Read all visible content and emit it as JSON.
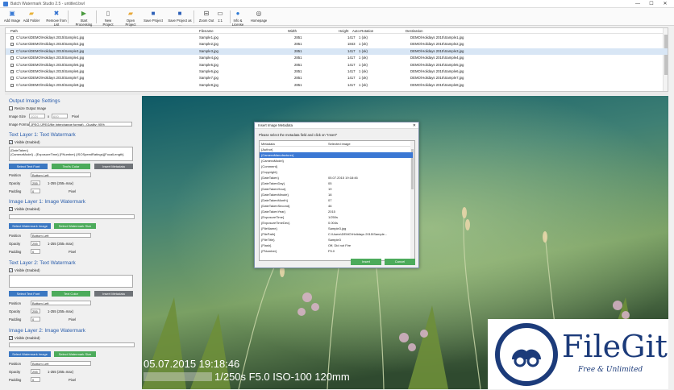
{
  "window": {
    "title": "Batch Watermark Studio 2.5 - untitled.bwl",
    "minimize": "—",
    "maximize": "☐",
    "close": "✕"
  },
  "ribbon": [
    {
      "label": "Add Image",
      "icon": "add-image-icon",
      "glyph": "▣",
      "color": "#3a7bd5"
    },
    {
      "label": "Add Folder",
      "icon": "add-folder-icon",
      "glyph": "▰",
      "color": "#e8b33a"
    },
    {
      "label": "Remove from List",
      "icon": "remove-icon",
      "glyph": "✖",
      "color": "#2f6fcf"
    },
    {
      "label": "Start Processing",
      "icon": "play-icon",
      "glyph": "▶",
      "color": "#4a9a3e"
    },
    {
      "label": "New Project",
      "icon": "new-project-icon",
      "glyph": "▯",
      "color": "#666666"
    },
    {
      "label": "Open Project",
      "icon": "open-project-icon",
      "glyph": "▰",
      "color": "#e8a93a"
    },
    {
      "label": "Save Project",
      "icon": "save-project-icon",
      "glyph": "■",
      "color": "#2f62b8"
    },
    {
      "label": "Save Project as ...",
      "icon": "save-as-icon",
      "glyph": "■",
      "color": "#2f62b8"
    },
    {
      "label": "Zoom Out",
      "icon": "zoom-out-icon",
      "glyph": "⊟",
      "color": "#444444"
    },
    {
      "label": "1:1",
      "icon": "actual-size-icon",
      "glyph": "▭",
      "color": "#444444"
    },
    {
      "label": "Info & License",
      "icon": "info-icon",
      "glyph": "●",
      "color": "#2f7bd5"
    },
    {
      "label": "Homepage",
      "icon": "homepage-icon",
      "glyph": "◎",
      "color": "#444444"
    }
  ],
  "list": {
    "headers": [
      "Path",
      "Filename",
      "Width",
      "Height",
      "Auto-Rotation",
      "Destination"
    ],
    "rows": [
      {
        "path": "C:\\Users\\DEMO\\Holidays 2015\\Sample1.jpg",
        "file": "Sample1.jpg",
        "w": "2851",
        "h": "1417",
        "rot": "1 (ok)",
        "dest": "DEMO\\Holidays 2015\\Sample1.jpg"
      },
      {
        "path": "C:\\Users\\DEMO\\Holidays 2015\\Sample2.jpg",
        "file": "Sample2.jpg",
        "w": "2851",
        "h": "1843",
        "rot": "1 (ok)",
        "dest": "DEMO\\Holidays 2015\\Sample2.jpg"
      },
      {
        "path": "C:\\Users\\DEMO\\Holidays 2015\\Sample3.jpg",
        "file": "Sample3.jpg",
        "w": "2851",
        "h": "1417",
        "rot": "1 (ok)",
        "dest": "DEMO\\Holidays 2015\\Sample3.jpg"
      },
      {
        "path": "C:\\Users\\DEMO\\Holidays 2015\\Sample4.jpg",
        "file": "Sample4.jpg",
        "w": "2851",
        "h": "1417",
        "rot": "1 (ok)",
        "dest": "DEMO\\Holidays 2015\\Sample4.jpg"
      },
      {
        "path": "C:\\Users\\DEMO\\Holidays 2015\\Sample5.jpg",
        "file": "Sample5.jpg",
        "w": "2851",
        "h": "1417",
        "rot": "1 (ok)",
        "dest": "DEMO\\Holidays 2015\\Sample5.jpg"
      },
      {
        "path": "C:\\Users\\DEMO\\Holidays 2015\\Sample6.jpg",
        "file": "Sample6.jpg",
        "w": "2851",
        "h": "1417",
        "rot": "1 (ok)",
        "dest": "DEMO\\Holidays 2015\\Sample6.jpg"
      },
      {
        "path": "C:\\Users\\DEMO\\Holidays 2015\\Sample7.jpg",
        "file": "Sample7.jpg",
        "w": "2851",
        "h": "1417",
        "rot": "1 (ok)",
        "dest": "DEMO\\Holidays 2015\\Sample7.jpg"
      },
      {
        "path": "C:\\Users\\DEMO\\Holidays 2015\\Sample8.jpg",
        "file": "Sample8.jpg",
        "w": "2851",
        "h": "1417",
        "rot": "1 (ok)",
        "dest": "DEMO\\Holidays 2015\\Sample8.jpg"
      }
    ]
  },
  "output": {
    "title": "Output Image Settings",
    "resize": "Resize Output Image",
    "size_label": "Image Size",
    "width": "1024",
    "x": "x",
    "height": "600",
    "unit": "Pixel",
    "format_label": "Image Format",
    "format": "JPEG (JPEG/file Interchange format) - Quality: 95%"
  },
  "text1": {
    "title": "Text Layer 1: Text Watermark",
    "visible": "Visible (Enabled)",
    "text": "{DateTaken}\n{CameraModel} - {ExposureTime} {FNumber} {ISOSpeedRatings}{FocalLength}",
    "select_font": "Select Text Font",
    "text_color": "Text's Color",
    "insert_meta": "Insert Metadata",
    "position_label": "Position",
    "position": "Bottom Left",
    "opacity_label": "Opacity",
    "opacity": "255",
    "opacity_hint": "1-255 (255=max)",
    "padding_label": "Padding",
    "padding": "0",
    "padding_unit": "Pixel"
  },
  "img1": {
    "title": "Image Layer 1: Image Watermark",
    "visible": "Visible (Enabled)",
    "select_img": "Select Watermark Image",
    "select_size": "Select Watermark Size",
    "position_label": "Position",
    "position": "Bottom Left",
    "opacity_label": "Opacity",
    "opacity": "255",
    "opacity_hint": "1-255 (255=max)",
    "padding_label": "Padding",
    "padding": "0",
    "padding_unit": "Pixel"
  },
  "text2": {
    "title": "Text Layer 2: Text Watermark",
    "visible": "Visible (Enabled)",
    "select_font": "Select Text Font",
    "text_color": "Text Color",
    "insert_meta": "Insert Metadata",
    "position_label": "Position",
    "position": "Bottom Left",
    "opacity_label": "Opacity",
    "opacity": "255",
    "opacity_hint": "1-255 (255=max)",
    "padding_label": "Padding",
    "padding": "0",
    "padding_unit": "Pixel"
  },
  "img2": {
    "title": "Image Layer 2: Image Watermark",
    "visible": "Visible (Enabled)",
    "select_img": "Select Watermark Image",
    "select_size": "Select Watermark Size",
    "position_label": "Position",
    "position": "Bottom Left",
    "opacity_label": "Opacity",
    "opacity": "255",
    "opacity_hint": "1-255 (255=max)",
    "padding_label": "Padding",
    "padding": "0",
    "padding_unit": "Pixel"
  },
  "preview": {
    "date": "05.07.2015 19:18:46",
    "exposure": "1/250s F5.0 ISO-100 120mm"
  },
  "dialog": {
    "title": "Insert Image Metadata",
    "prompt": "Please select the metadata field and click on \"Insert\"",
    "col1": "Metadata",
    "col2": "Selected image",
    "insert": "Insert",
    "cancel": "Cancel",
    "rows": [
      [
        "{Author}",
        ""
      ],
      [
        "{CameraManufacturer}",
        ""
      ],
      [
        "{CameraModel}",
        ""
      ],
      [
        "{Comment}",
        ""
      ],
      [
        "{Copyright}",
        ""
      ],
      [
        "{DateTaken}",
        "05.07.2015 19:18:46"
      ],
      [
        "{DateTakenDay}",
        "05"
      ],
      [
        "{DateTakenHour}",
        "19"
      ],
      [
        "{DateTakenMinute}",
        "18"
      ],
      [
        "{DateTakenMonth}",
        "07"
      ],
      [
        "{DateTakenSecond}",
        "46"
      ],
      [
        "{DateTakenYear}",
        "2015"
      ],
      [
        "{ExposureTime}",
        "1/250s"
      ],
      [
        "{ExposureTimeDec}",
        "0.004s"
      ],
      [
        "{FileName}",
        "Sample3.jpg"
      ],
      [
        "{FilePath}",
        "C:\\Users\\DEMO\\Holidays 2015\\Sample..."
      ],
      [
        "{FileTitle}",
        "Sample3"
      ],
      [
        "{Flash}",
        "Off, Did not Fire"
      ],
      [
        "{FNumber}",
        "F5.0"
      ]
    ]
  },
  "logo": {
    "name": "FileGit",
    "tagline": "Free & Unlimited"
  }
}
